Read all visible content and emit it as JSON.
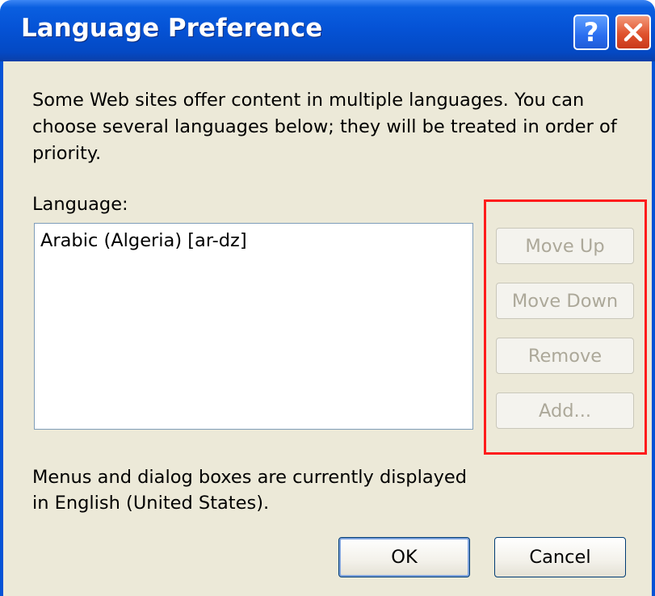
{
  "window": {
    "title": "Language Preference",
    "help_glyph": "?",
    "help_icon": "help-icon",
    "close_icon": "close-icon"
  },
  "content": {
    "description": "Some Web sites offer content in multiple languages. You can choose several languages below; they will be treated in order of priority.",
    "language_label": "Language:",
    "languages": [
      "Arabic (Algeria) [ar-dz]"
    ],
    "buttons": {
      "move_up": "Move Up",
      "move_down": "Move Down",
      "remove": "Remove",
      "add": "Add..."
    },
    "display_note_line1": "Menus and dialog boxes are currently displayed",
    "display_note_line2": "in English (United States)."
  },
  "footer": {
    "ok": "OK",
    "cancel": "Cancel"
  },
  "colors": {
    "titlebar": "#0553d6",
    "dialog_bg": "#ece9d8",
    "highlight_border": "#ff1c1c",
    "disabled_text": "#aca899"
  }
}
